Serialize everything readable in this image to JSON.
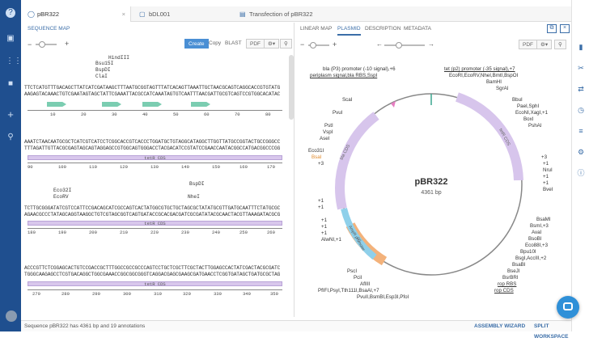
{
  "nav": {
    "icons": [
      "help-icon",
      "briefcase-icon",
      "grid-icon",
      "folder-icon",
      "plus-icon",
      "search-icon"
    ]
  },
  "tabs": [
    {
      "label": "pBR322",
      "icon": "circle-icon"
    },
    {
      "label": "bDL001",
      "icon": "document-icon"
    },
    {
      "label": "Transfection of pBR322",
      "icon": "notebook-icon"
    }
  ],
  "left": {
    "subtab": "SEQUENCE MAP",
    "buttons": {
      "create": "Create",
      "copy": "Copy",
      "blast": "BLAST",
      "pdf": "PDF"
    },
    "blocks": [
      {
        "enzymes": [
          "HindIII",
          "Bsu15I",
          "BspDI",
          "ClaI"
        ],
        "top": "TTCTCATGTTTGACAGCTTATCATCGATAAGCTTTAATGCGGTAGTTTATCACAGTTAAATTGCTAACGCAGTCAGGCACCGTGTATG",
        "bot": "AAGAGTACAAACTGTCGAATAGTAGCTATTCGAAATTACGCCATCAAATAGTGTCAATTTAACGATTGCGTCAGTCCGTGGCACATAC",
        "ticks": [
          "10",
          "20",
          "30",
          "40",
          "50",
          "60",
          "70",
          "80"
        ],
        "cds": ""
      },
      {
        "enzymes": [],
        "top": "AAATCTAACAATGCGCTCATCGTCATCCTCGGCACCGTCACCCTGGATGCTGTAGGCATAGGCTTGGTTATGCCGGTACTGCCGGGCC",
        "bot": "TTTAGATTGTTACGCGAGTAGCAGTAGGAGCCGTGGCAGTGGGACCTACGACATCCGTATCCGAACCAATACGGCCATGACGGCCCGG",
        "ticks": [
          "90",
          "100",
          "110",
          "120",
          "130",
          "140",
          "150",
          "160",
          "170"
        ],
        "cds": "tetR CDS"
      },
      {
        "enzymes": [
          "Eco32I",
          "EcoRV",
          "BspDI",
          "NheI"
        ],
        "top": "TCTTGCGGGATATCGTCCATTCCGACAGCATCGCCAGTCACTATGGCGTGCTGCTAGCGCTATATGCGTTGATGCAATTTCTATGCGC",
        "bot": "AGAACGCCCTATAGCAGGTAAGGCTGTCGTAGCGGTCAGTGATACCGCACGACGATCGCGATATACGCAACTACGTTAAAGATACGCG",
        "ticks": [
          "180",
          "190",
          "200",
          "210",
          "220",
          "230",
          "240",
          "250",
          "260"
        ],
        "cds": "tetR CDS"
      },
      {
        "enzymes": [],
        "top": "ACCCGTTCTCGGAGCACTGTCCGACCGCTTTGGCCGCCGCCCAGTCCTGCTCGCTTCGCTACTTGGAGCCACTATCGACTACGCGATC",
        "bot": "TGGGCAAGAGCCTCGTGACAGGCTGGCGAAACCGGCGGCGGGTCAGGACGAGCGAAGCGATGAACCTCGGTGATAGCTGATGCGCTAG",
        "ticks": [
          "270",
          "280",
          "290",
          "300",
          "310",
          "320",
          "330",
          "340",
          "350"
        ],
        "cds": "tetR CDS"
      }
    ]
  },
  "right": {
    "subtabs": [
      "LINEAR MAP",
      "PLASMID",
      "DESCRIPTION",
      "METADATA"
    ],
    "pdf": "PDF",
    "plasmid": {
      "name": "pBR322",
      "size": "4361 bp"
    },
    "labels_top": [
      "bla (P3) promoter (-10 signal),+6",
      "periplasm signal,bla RBS,SspI",
      "tet (p2) promoter (-35 signal),+7",
      "EcoRI,EcoRV,NheI,BmtI,BspOI",
      "BamHI",
      "SgrAI",
      "BbuI",
      "PaeI,SphI",
      "EcoNI,XagI,+1",
      "BoxI",
      "PshAI"
    ],
    "labels_left": [
      "ScaI",
      "PvuI",
      "PstI",
      "VspI",
      "AseI",
      "Eco31I",
      "BsaI",
      "+3",
      "+1",
      "+1",
      "+1",
      "+1",
      "+1",
      "AlwNI,+1"
    ],
    "labels_right": [
      "+3",
      "+1",
      "NruI",
      "+1",
      "+1",
      "BveI",
      "BsaMI",
      "BsmI,+3",
      "AvaI",
      "BsoBI",
      "Eco88I,+3",
      "Bpu10I",
      "BsgI,AccIII,+2",
      "BsaBI",
      "BseJI",
      "BsrBRI",
      "rop RBS",
      "rop CDS"
    ],
    "labels_bottom": [
      "PscI",
      "PciI",
      "AflIII",
      "PfIFI,PsyI,Tth111I,BsaAI,+7",
      "PvuII,BsmBI,Esp3I,PfoI"
    ],
    "features": [
      "bla CDS",
      "tetR CDS",
      "ori",
      "AmpR promoter"
    ]
  },
  "status": {
    "text": "Sequence pBR322 has 4361 bp and 19 annotations",
    "wizard": "ASSEMBLY WIZARD",
    "split": "SPLIT WORKSPACE"
  }
}
